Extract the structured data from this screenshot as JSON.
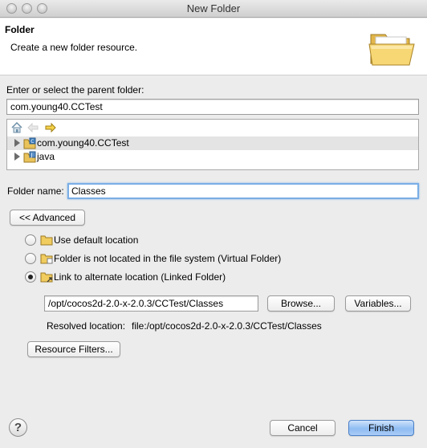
{
  "window": {
    "title": "New Folder"
  },
  "banner": {
    "title": "Folder",
    "description": "Create a new folder resource.",
    "icon": "folder-open-icon"
  },
  "parent": {
    "label": "Enter or select the parent folder:",
    "value": "com.young40.CCTest"
  },
  "tree": {
    "toolbar": [
      "home-icon",
      "back-icon",
      "forward-icon"
    ],
    "items": [
      {
        "label": "com.young40.CCTest",
        "icon": "project-icon",
        "selected": true
      },
      {
        "label": "java",
        "icon": "java-project-icon",
        "selected": false
      }
    ]
  },
  "folder_name": {
    "label": "Folder name:",
    "value": "Classes"
  },
  "advanced_button": "<< Advanced",
  "options": [
    {
      "label": "Use default location",
      "checked": false
    },
    {
      "label": "Folder is not located in the file system (Virtual Folder)",
      "checked": false
    },
    {
      "label": "Link to alternate location (Linked Folder)",
      "checked": true
    }
  ],
  "link": {
    "path": "/opt/cocos2d-2.0-x-2.0.3/CCTest/Classes",
    "browse_button": "Browse...",
    "variables_button": "Variables...",
    "resolved_label": "Resolved location:",
    "resolved_value": "file:/opt/cocos2d-2.0-x-2.0.3/CCTest/Classes"
  },
  "resource_filters_button": "Resource Filters...",
  "footer": {
    "help": "?",
    "cancel": "Cancel",
    "finish": "Finish"
  }
}
